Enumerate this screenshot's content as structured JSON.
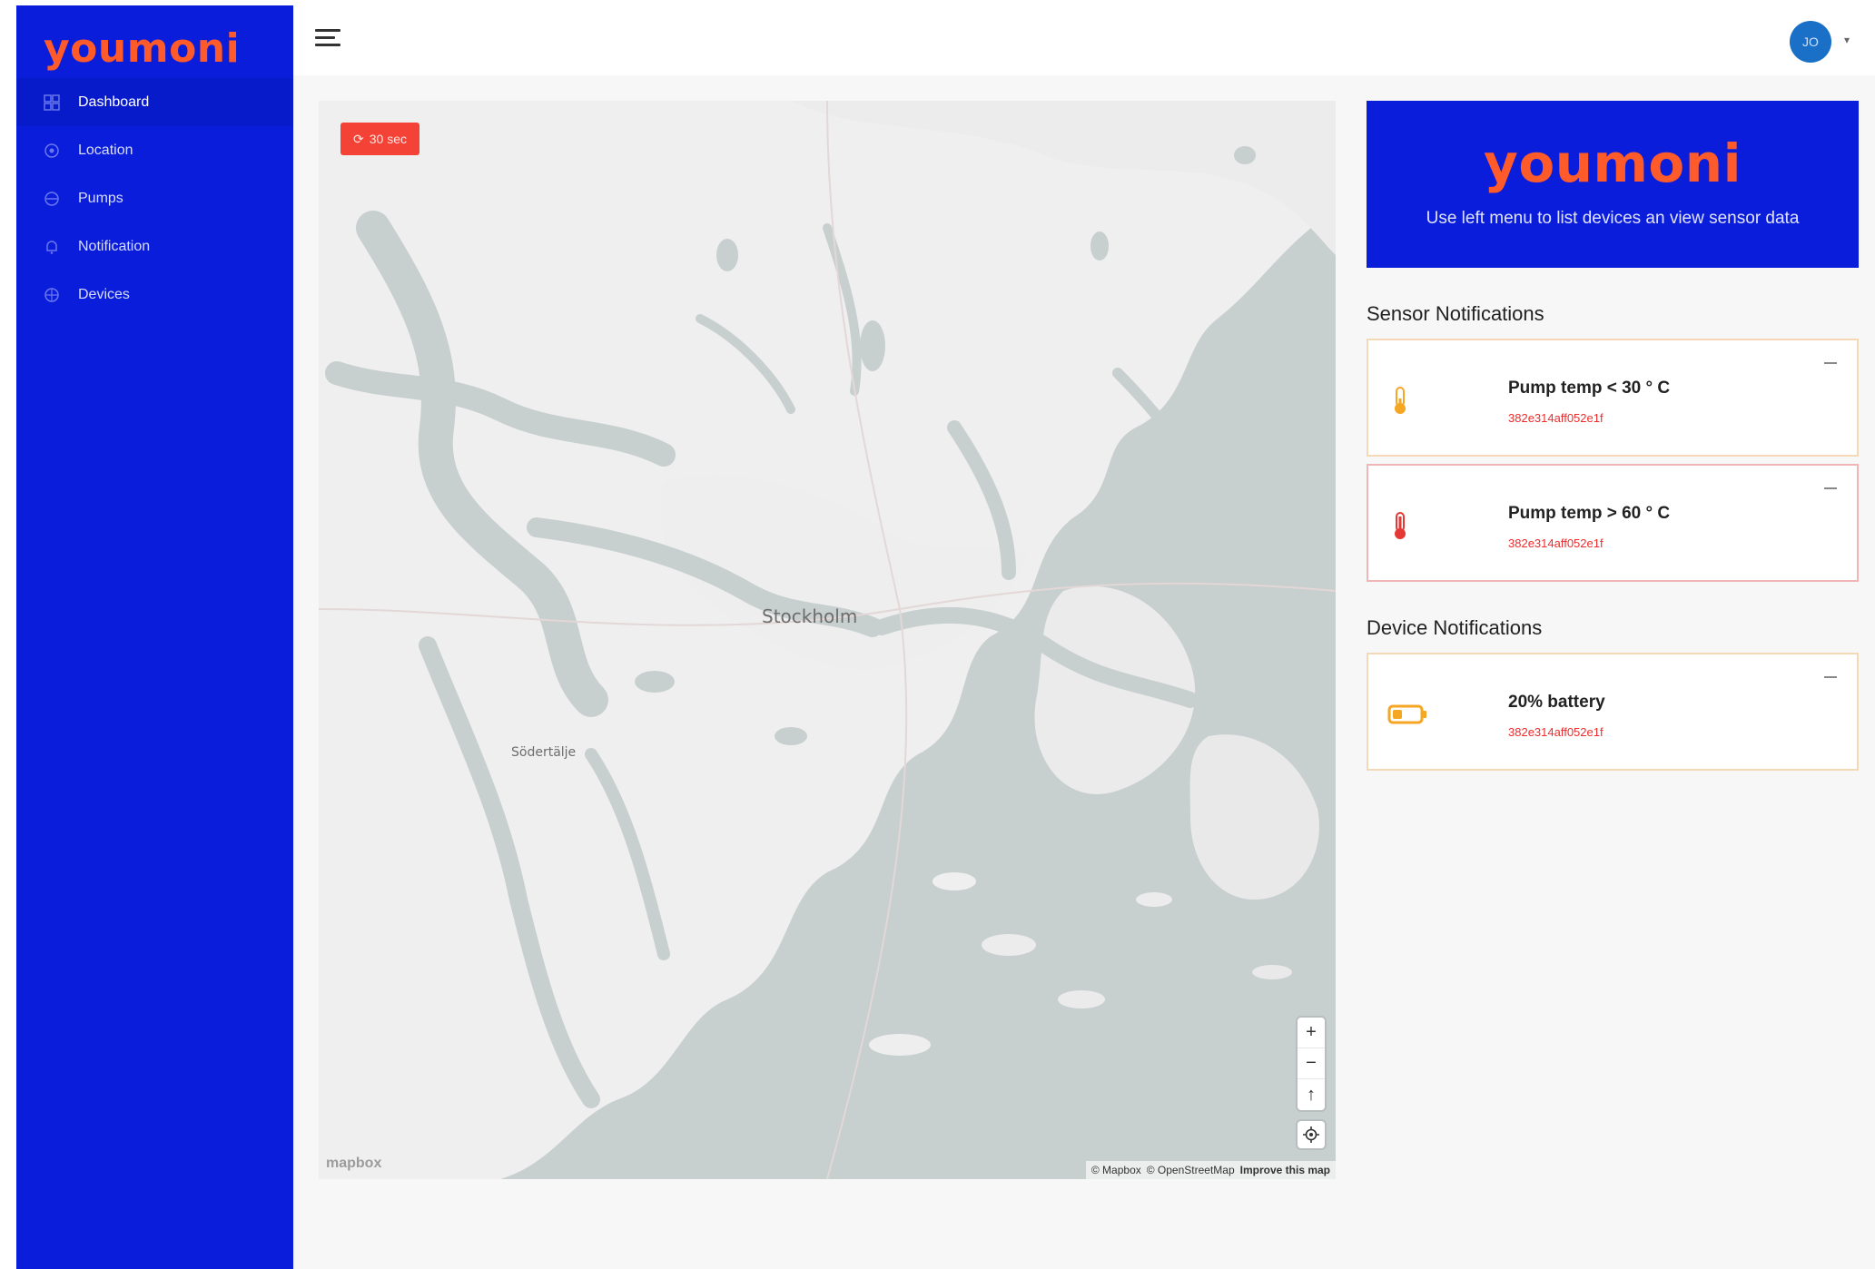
{
  "app": {
    "brand": "youmoni"
  },
  "sidebar": {
    "items": [
      {
        "label": "Dashboard",
        "icon": "dashboard-icon",
        "active": true
      },
      {
        "label": "Location",
        "icon": "location-icon",
        "active": false
      },
      {
        "label": "Pumps",
        "icon": "pump-icon",
        "active": false
      },
      {
        "label": "Notification",
        "icon": "bell-icon",
        "active": false
      },
      {
        "label": "Devices",
        "icon": "device-icon",
        "active": false
      }
    ]
  },
  "topbar": {
    "avatar_initials": "JO"
  },
  "map": {
    "refresh_label": "30 sec",
    "labels": {
      "stockholm": "Stockholm",
      "sodertalje": "Södertälje"
    },
    "logo": "mapbox",
    "attribution": {
      "mapbox": "© Mapbox",
      "osm": "© OpenStreetMap",
      "improve": "Improve this map"
    },
    "controls": {
      "zoom_in": "+",
      "zoom_out": "−",
      "compass": "↑"
    }
  },
  "panel": {
    "brand_card": {
      "logo": "youmoni",
      "text": "Use left menu to list devices an view sensor data"
    },
    "sensor_title": "Sensor Notifications",
    "sensor_notifications": [
      {
        "title": "Pump temp < 30 ° C",
        "device_id": "382e314aff052e1f",
        "icon": "thermometer-low-icon",
        "color": "#f5a623"
      },
      {
        "title": "Pump temp > 60 ° C",
        "device_id": "382e314aff052e1f",
        "icon": "thermometer-high-icon",
        "color": "#e53935"
      }
    ],
    "device_title": "Device Notifications",
    "device_notifications": [
      {
        "title": "20% battery",
        "device_id": "382e314aff052e1f",
        "icon": "battery-icon",
        "color": "#f5a623"
      }
    ]
  },
  "colors": {
    "brand_blue": "#0a1ddb",
    "brand_orange": "#ff5a2a",
    "alert_red": "#f44336"
  }
}
